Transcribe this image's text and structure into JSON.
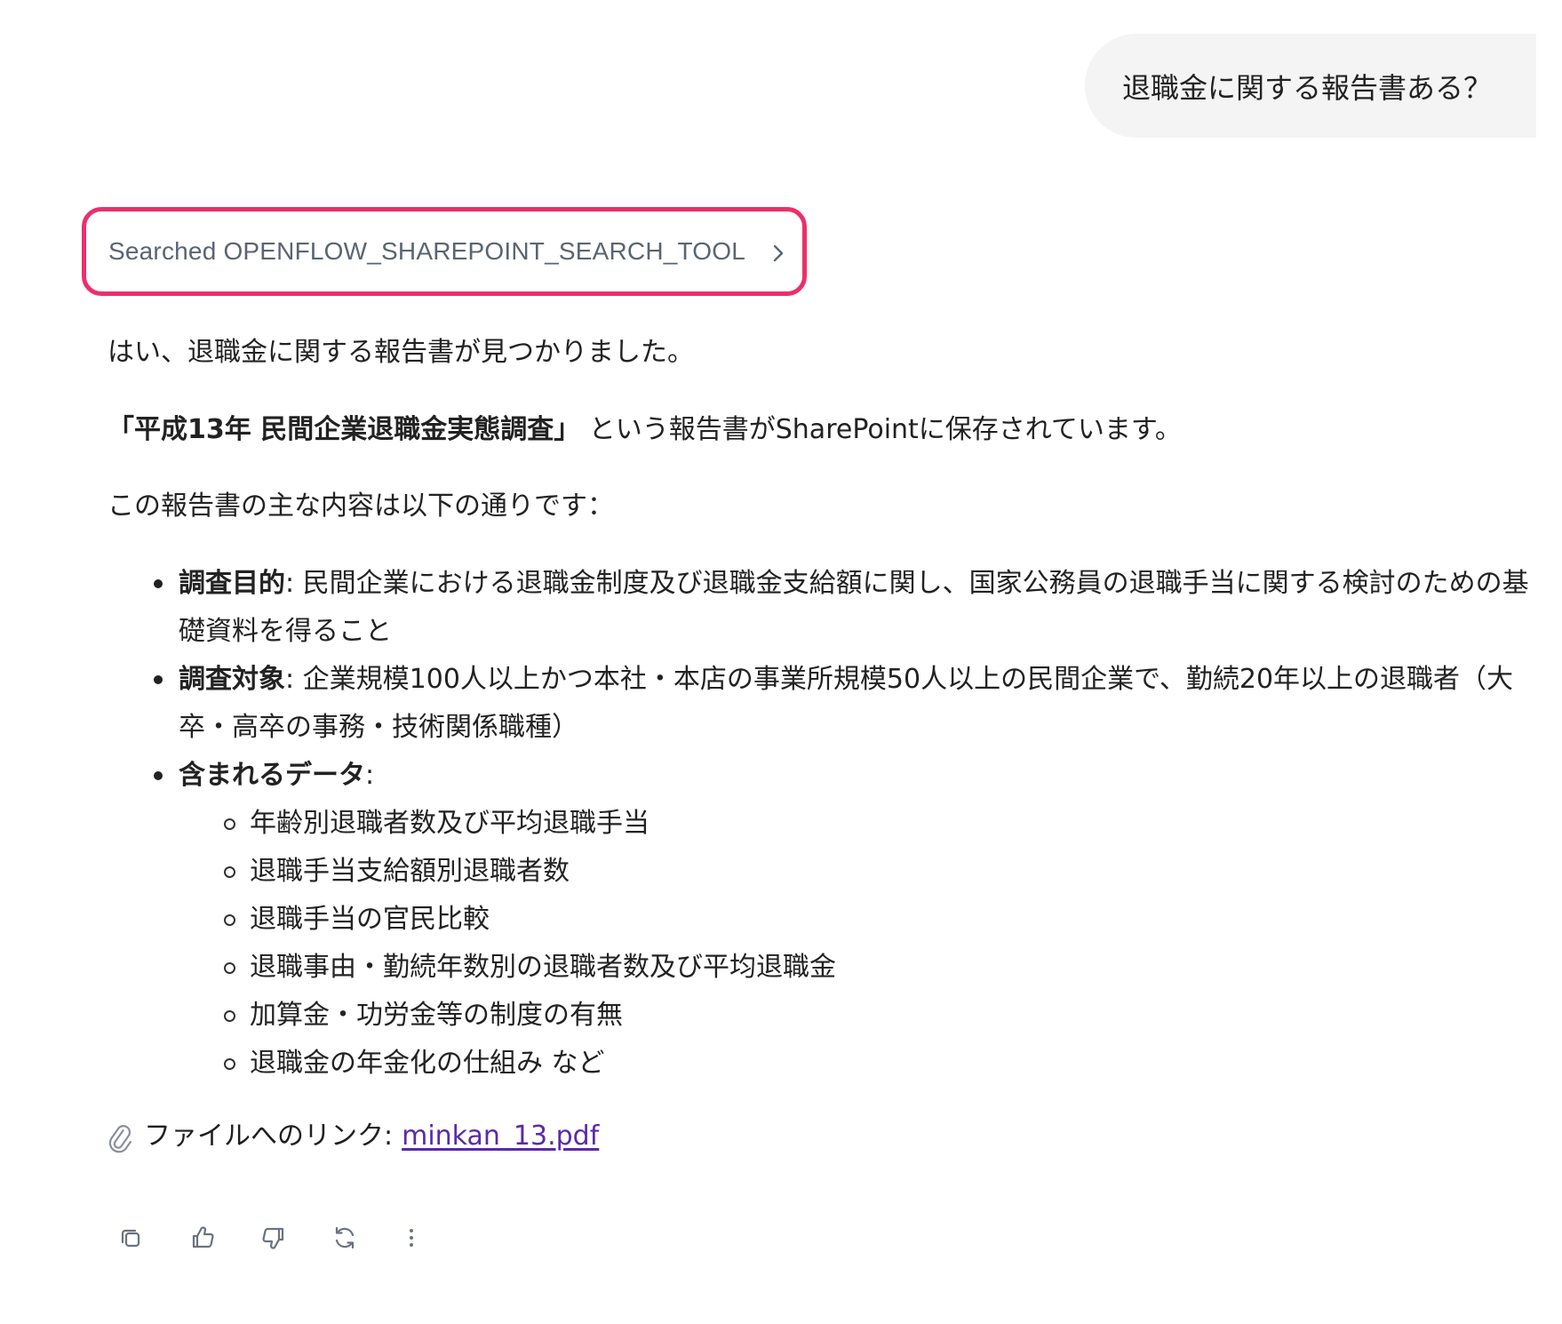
{
  "user_message": {
    "text": "退職金に関する報告書ある？"
  },
  "tool_call": {
    "label": "Searched OPENFLOW_SHAREPOINT_SEARCH_TOOL",
    "accent_color": "#ec2f6c",
    "chevron_icon": "chevron-right-icon"
  },
  "reply": {
    "intro": "はい、退職金に関する報告書が見つかりました。",
    "report_title": "「平成13年 民間企業退職金実態調査」",
    "report_suffix": "という報告書がSharePointに保存されています。",
    "contents_intro": "この報告書の主な内容は以下の通りです：",
    "bullets": [
      {
        "label": "調査目的",
        "text": ": 民間企業における退職金制度及び退職金支給額に関し、国家公務員の退職手当に関する検討のための基礎資料を得ること"
      },
      {
        "label": "調査対象",
        "text": ": 企業規模100人以上かつ本社・本店の事業所規模50人以上の民間企業で、勤続20年以上の退職者（大卒・高卒の事務・技術関係職種）"
      },
      {
        "label": "含まれるデータ",
        "text": ":",
        "subitems": [
          "年齢別退職者数及び平均退職手当",
          "退職手当支給額別退職者数",
          "退職手当の官民比較",
          "退職事由・勤続年数別の退職者数及び平均退職金",
          "加算金・功労金等の制度の有無",
          "退職金の年金化の仕組み など"
        ]
      }
    ],
    "file_prefix": "ファイルへのリンク:",
    "file_link": "minkan_13.pdf",
    "file_icon": "paperclip-icon"
  },
  "actions": [
    {
      "icon": "copy-icon"
    },
    {
      "icon": "thumbs-up-icon"
    },
    {
      "icon": "thumbs-down-icon"
    },
    {
      "icon": "regenerate-icon"
    },
    {
      "icon": "more-vertical-icon"
    }
  ]
}
